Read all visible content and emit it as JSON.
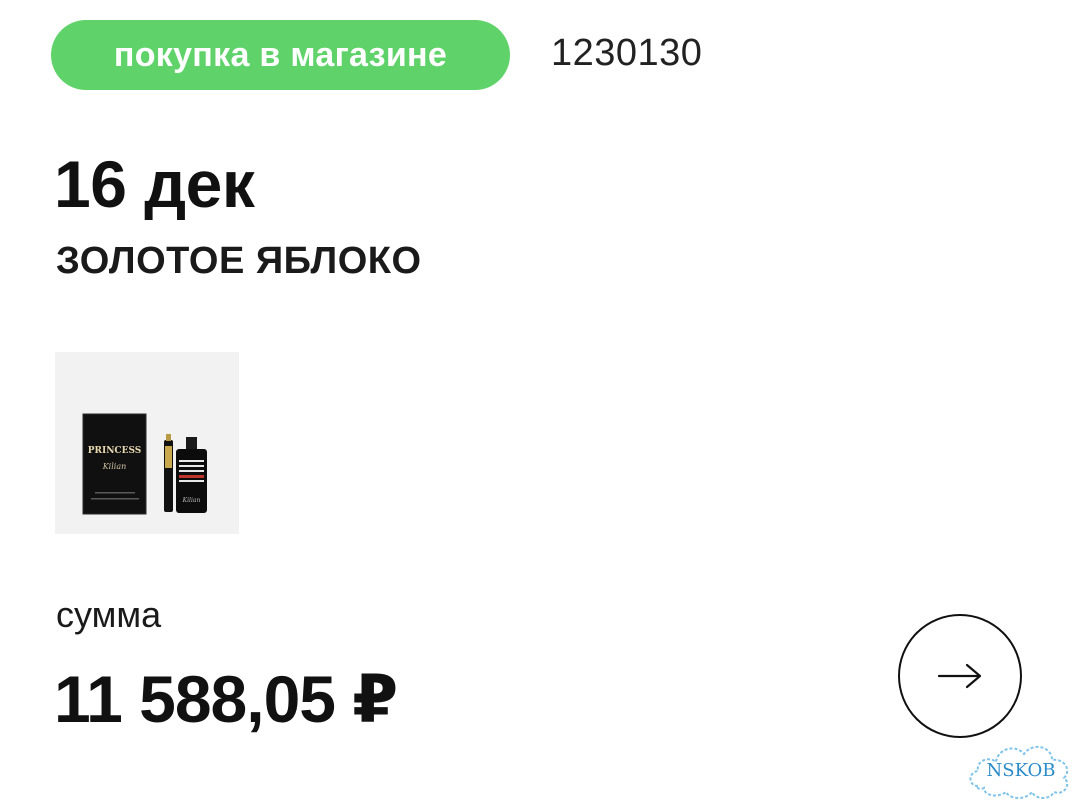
{
  "purchase": {
    "type_badge": "покупка в магазине",
    "order_number": "1230130",
    "date": "16 дек",
    "store_name": "ЗОЛОТОЕ ЯБЛОКО",
    "sum_label": "сумма",
    "sum_value": "11 588,05 ₽"
  },
  "product_image": {
    "box_text_line1": "PRINCESS",
    "box_text_line2": "Kilian",
    "bottle_label": "Kilian"
  },
  "actions": {
    "open_icon": "arrow-right-icon"
  },
  "watermark": {
    "text": "NSKOB"
  },
  "colors": {
    "badge": "#5fd36a",
    "text": "#111111",
    "background": "#ffffff",
    "watermark": "#2b8bc9"
  }
}
